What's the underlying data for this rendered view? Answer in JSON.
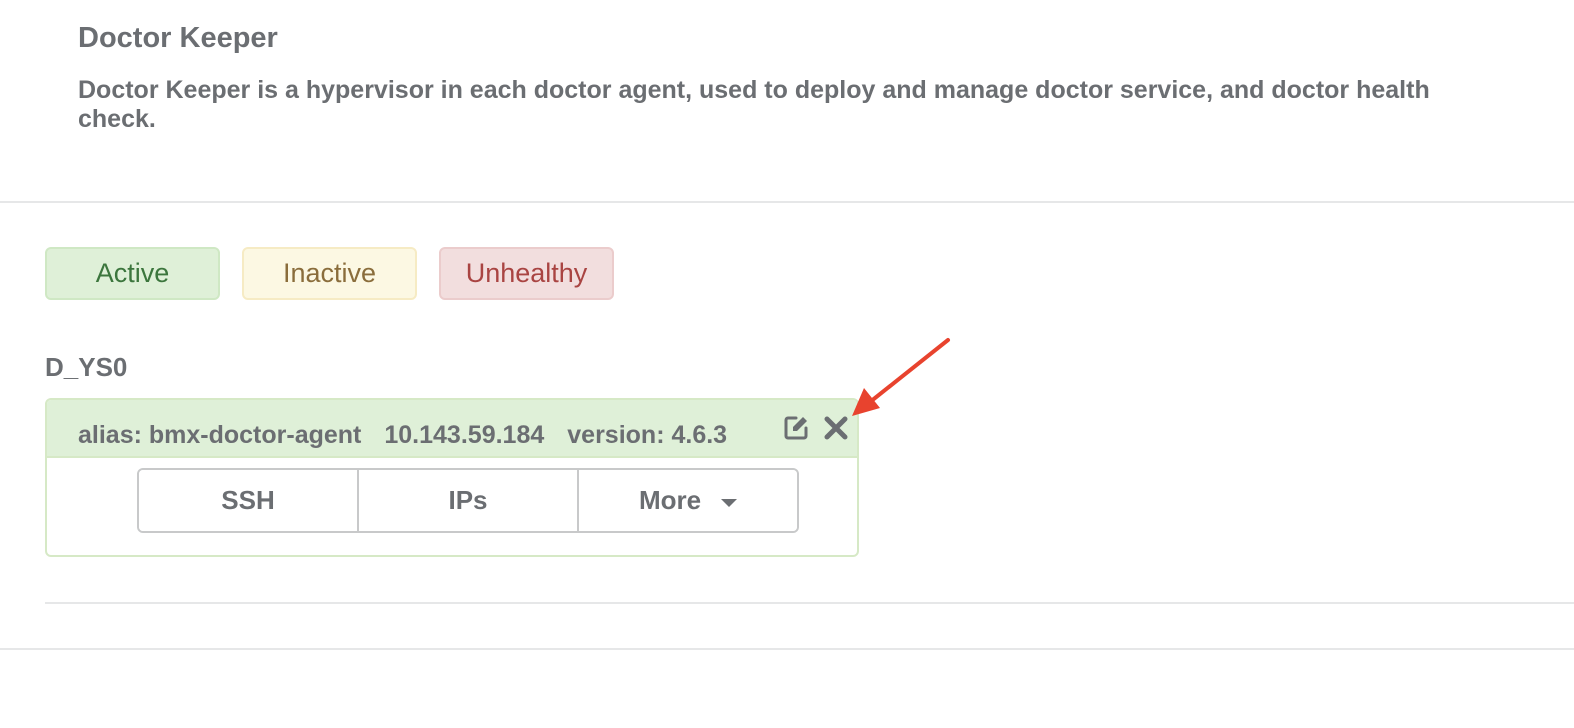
{
  "header": {
    "title": "Doctor Keeper",
    "description": "Doctor Keeper is a hypervisor in each doctor agent, used to deploy and manage doctor service, and doctor health check."
  },
  "legend": {
    "active": "Active",
    "inactive": "Inactive",
    "unhealthy": "Unhealthy"
  },
  "group": {
    "title": "D_YS0"
  },
  "agent": {
    "alias": "alias: bmx-doctor-agent",
    "ip": "10.143.59.184",
    "version": "version: 4.6.3",
    "icons": [
      "edit-icon",
      "close-icon"
    ],
    "buttons": {
      "ssh": "SSH",
      "ips": "IPs",
      "more": "More"
    }
  },
  "colors": {
    "active_bg": "#dff0d8",
    "inactive_bg": "#fcf8e3",
    "unhealthy_bg": "#f2dede",
    "annotation_arrow": "#e8432e"
  }
}
